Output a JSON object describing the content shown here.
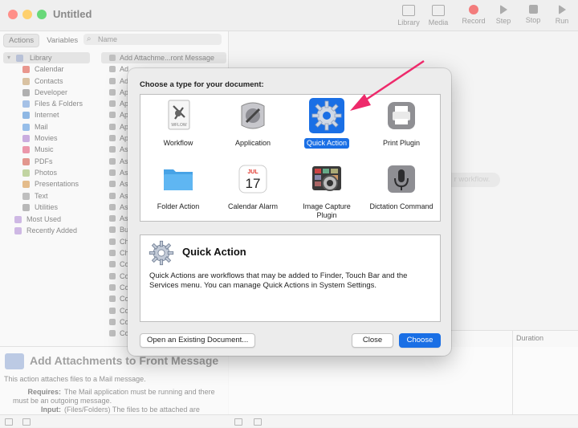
{
  "window": {
    "title": "Untitled",
    "toolbar": [
      {
        "label": "Library",
        "icon": "library-icon"
      },
      {
        "label": "Media",
        "icon": "media-icon"
      },
      {
        "label": "Record",
        "icon": "record-icon"
      },
      {
        "label": "Step",
        "icon": "step-icon"
      },
      {
        "label": "Stop",
        "icon": "stop-icon"
      },
      {
        "label": "Run",
        "icon": "run-icon"
      }
    ]
  },
  "sidebar": {
    "tabs": [
      "Actions",
      "Variables"
    ],
    "active_tab": "Actions",
    "search_placeholder": "Name",
    "library": [
      {
        "label": "Library",
        "kind": "root"
      },
      {
        "label": "Calendar",
        "color": "#e06a5e"
      },
      {
        "label": "Contacts",
        "color": "#c9a87a"
      },
      {
        "label": "Developer",
        "color": "#8e8e8e"
      },
      {
        "label": "Files & Folders",
        "color": "#7ea7dc"
      },
      {
        "label": "Internet",
        "color": "#5f9ad8"
      },
      {
        "label": "Mail",
        "color": "#6aa3e0"
      },
      {
        "label": "Movies",
        "color": "#b48ad2"
      },
      {
        "label": "Music",
        "color": "#e26a86"
      },
      {
        "label": "PDFs",
        "color": "#d66a5e"
      },
      {
        "label": "Photos",
        "color": "#a6c27a"
      },
      {
        "label": "Presentations",
        "color": "#d8a05a"
      },
      {
        "label": "Text",
        "color": "#a4a4a4"
      },
      {
        "label": "Utilities",
        "color": "#9a9a9a"
      },
      {
        "label": "Most Used",
        "kind": "group"
      },
      {
        "label": "Recently Added",
        "kind": "group"
      }
    ],
    "actions": [
      {
        "label": "Add Attachme...ront Message",
        "selected": true
      },
      {
        "label": "Ad"
      },
      {
        "label": "Ad"
      },
      {
        "label": "Ap"
      },
      {
        "label": "Ap"
      },
      {
        "label": "Ap"
      },
      {
        "label": "Ap"
      },
      {
        "label": "Ap"
      },
      {
        "label": "As"
      },
      {
        "label": "As"
      },
      {
        "label": "As"
      },
      {
        "label": "As"
      },
      {
        "label": "As"
      },
      {
        "label": "As"
      },
      {
        "label": "As"
      },
      {
        "label": "Bu"
      },
      {
        "label": "Ch"
      },
      {
        "label": "Ch"
      },
      {
        "label": "Co"
      },
      {
        "label": "Co"
      },
      {
        "label": "Co"
      },
      {
        "label": "Co"
      },
      {
        "label": "Co"
      },
      {
        "label": "Co"
      },
      {
        "label": "Co"
      }
    ]
  },
  "canvas": {
    "hint": "r workflow.",
    "log_column": "Duration"
  },
  "description": {
    "title": "Add Attachments to Front Message",
    "summary": "This action attaches files to a Mail message.",
    "requires_label": "Requires:",
    "requires_text": "The Mail application must be running and there must be an outgoing message.",
    "input_label": "Input:",
    "input_text": "(Files/Folders) The files to be attached are"
  },
  "dialog": {
    "prompt": "Choose a type for your document:",
    "types": [
      {
        "label": "Workflow",
        "icon": "workflow-icon",
        "sublabel": "WFLOW"
      },
      {
        "label": "Application",
        "icon": "application-icon"
      },
      {
        "label": "Quick Action",
        "icon": "quick-action-gear-icon",
        "selected": true
      },
      {
        "label": "Print Plugin",
        "icon": "printer-icon"
      },
      {
        "label": "Folder Action",
        "icon": "folder-icon"
      },
      {
        "label": "Calendar Alarm",
        "icon": "calendar-icon",
        "month": "JUL",
        "day": "17"
      },
      {
        "label": "Image Capture Plugin",
        "icon": "image-capture-icon"
      },
      {
        "label": "Dictation Command",
        "icon": "microphone-icon"
      }
    ],
    "selected_title": "Quick Action",
    "selected_description": "Quick Actions are workflows that may be added to Finder, Touch Bar and the Services menu. You can manage Quick Actions in System Settings.",
    "buttons": {
      "open_existing": "Open an Existing Document...",
      "close": "Close",
      "choose": "Choose"
    }
  },
  "colors": {
    "accent": "#1a6fe5",
    "annotation_arrow": "#ee2a6b"
  }
}
